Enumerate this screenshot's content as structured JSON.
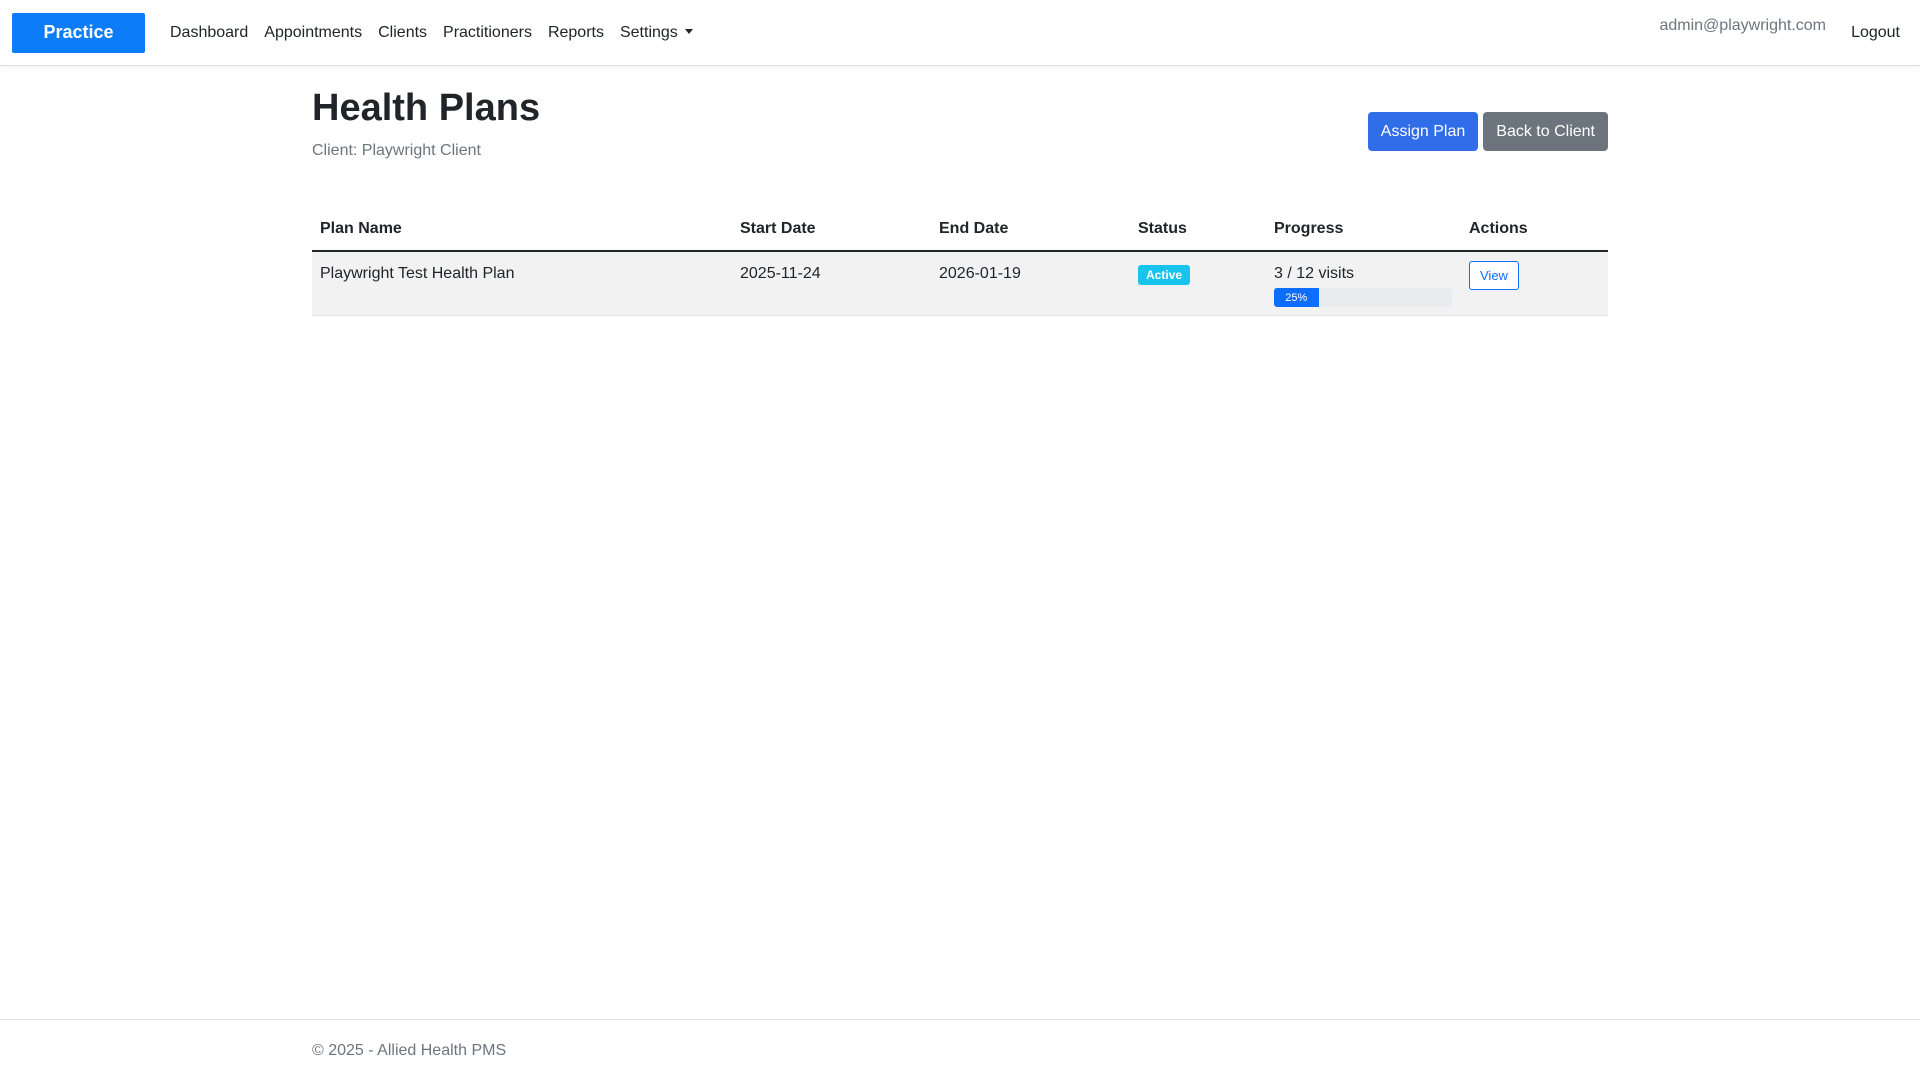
{
  "navbar": {
    "brand": "Practice",
    "brand_color": "#0d7cf9",
    "links": [
      "Dashboard",
      "Appointments",
      "Clients",
      "Practitioners",
      "Reports",
      "Settings"
    ],
    "user_email": "admin@playwright.com",
    "logout": "Logout"
  },
  "page": {
    "title": "Health Plans",
    "client_label": "Client: Playwright Client",
    "assign_button": "Assign Plan",
    "back_button": "Back to Client"
  },
  "table": {
    "headers": [
      "Plan Name",
      "Start Date",
      "End Date",
      "Status",
      "Progress",
      "Actions"
    ],
    "rows": [
      {
        "plan_name": "Playwright Test Health Plan",
        "start_date": "2025-11-24",
        "end_date": "2026-01-19",
        "status": "Active",
        "status_color": "#19c4ec",
        "progress_text": "3 / 12 visits",
        "progress_percent": 25,
        "progress_label": "25%",
        "action": "View"
      }
    ]
  },
  "footer": {
    "text": "© 2025 - Allied Health PMS"
  }
}
